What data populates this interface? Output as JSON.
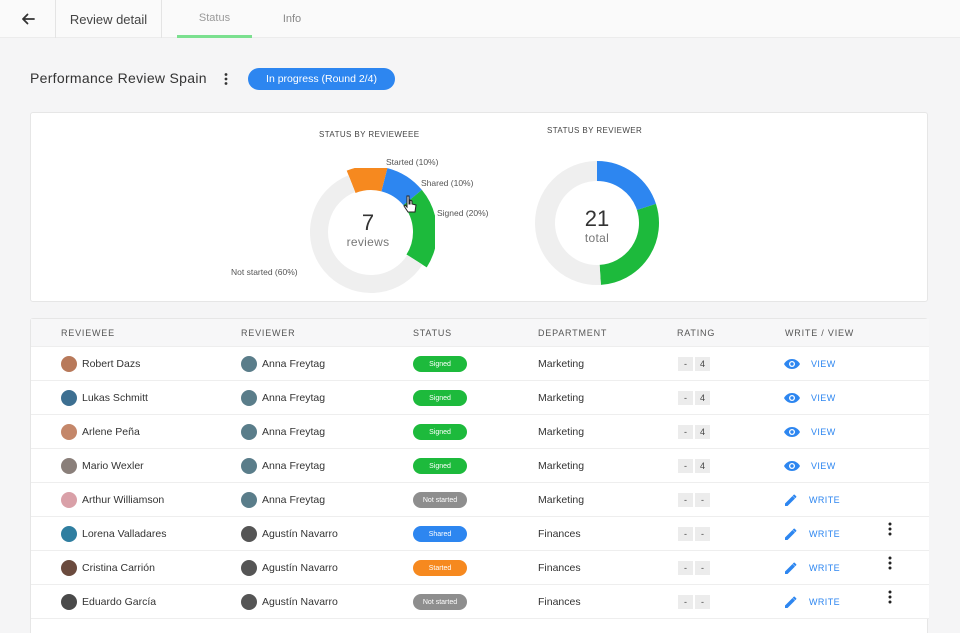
{
  "header": {
    "back_icon": "arrow-left-icon",
    "breadcrumb": "Review detail",
    "tabs": [
      {
        "label": "Status",
        "active": true
      },
      {
        "label": "Info",
        "active": false
      }
    ]
  },
  "review": {
    "title": "Performance Review Spain",
    "menu_icon": "more-vertical-icon",
    "status": "In progress (Round 2/4)"
  },
  "charts": {
    "by_reviewee": {
      "title": "STATUS BY REVIEWEEE",
      "center_value": "7",
      "center_label": "reviews",
      "labels": {
        "started": "Started (10%)",
        "shared": "Shared (10%)",
        "signed": "Signed (20%)",
        "not_started": "Not started (60%)"
      }
    },
    "by_reviewer": {
      "title": "STATUS BY REVIEWER",
      "center_value": "21",
      "center_label": "total"
    }
  },
  "chart_data": [
    {
      "type": "pie",
      "title": "STATUS BY REVIEWEEE",
      "categories": [
        "Not started",
        "Started",
        "Shared",
        "Signed"
      ],
      "values": [
        60,
        10,
        10,
        20
      ],
      "colors": [
        "#efefef",
        "#f6891f",
        "#2d86f0",
        "#1dba3c"
      ]
    },
    {
      "type": "pie",
      "title": "STATUS BY REVIEWER",
      "categories": [
        "Shared",
        "Signed",
        "Not started"
      ],
      "values": [
        20,
        29,
        51
      ],
      "colors": [
        "#2d86f0",
        "#1dba3c",
        "#efefef"
      ]
    }
  ],
  "table": {
    "headers": [
      "REVIEWEE",
      "REVIEWER",
      "STATUS",
      "DEPARTMENT",
      "RATING",
      "WRITE / VIEW"
    ],
    "rows": [
      {
        "reviewee": "Robert Dazs",
        "reviewer": "Anna Freytag",
        "status": "Signed",
        "status_color": "#1dba3c",
        "department": "Marketing",
        "rating": [
          "-",
          "4"
        ],
        "action": "VIEW",
        "action_icon": "eye-icon",
        "has_menu": false,
        "reviewee_avatar": "#b8795a",
        "reviewer_avatar": "#5a7d8a"
      },
      {
        "reviewee": "Lukas Schmitt",
        "reviewer": "Anna Freytag",
        "status": "Signed",
        "status_color": "#1dba3c",
        "department": "Marketing",
        "rating": [
          "-",
          "4"
        ],
        "action": "VIEW",
        "action_icon": "eye-icon",
        "has_menu": false,
        "reviewee_avatar": "#3d6f91",
        "reviewer_avatar": "#5a7d8a"
      },
      {
        "reviewee": "Arlene Peña",
        "reviewer": "Anna Freytag",
        "status": "Signed",
        "status_color": "#1dba3c",
        "department": "Marketing",
        "rating": [
          "-",
          "4"
        ],
        "action": "VIEW",
        "action_icon": "eye-icon",
        "has_menu": false,
        "reviewee_avatar": "#c4876a",
        "reviewer_avatar": "#5a7d8a"
      },
      {
        "reviewee": "Mario Wexler",
        "reviewer": "Anna Freytag",
        "status": "Signed",
        "status_color": "#1dba3c",
        "department": "Marketing",
        "rating": [
          "-",
          "4"
        ],
        "action": "VIEW",
        "action_icon": "eye-icon",
        "has_menu": false,
        "reviewee_avatar": "#8a7f7a",
        "reviewer_avatar": "#5a7d8a"
      },
      {
        "reviewee": "Arthur Williamson",
        "reviewer": "Anna Freytag",
        "status": "Not started",
        "status_color": "#8e8e8e",
        "department": "Marketing",
        "rating": [
          "-",
          "-"
        ],
        "action": "WRITE",
        "action_icon": "pencil-icon",
        "has_menu": false,
        "reviewee_avatar": "#d9a0a8",
        "reviewer_avatar": "#5a7d8a"
      },
      {
        "reviewee": "Lorena Valladares",
        "reviewer": "Agustín Navarro",
        "status": "Shared",
        "status_color": "#2d86f0",
        "department": "Finances",
        "rating": [
          "-",
          "-"
        ],
        "action": "WRITE",
        "action_icon": "pencil-icon",
        "has_menu": true,
        "reviewee_avatar": "#2f7ea0",
        "reviewer_avatar": "#555555"
      },
      {
        "reviewee": "Cristina Carrión",
        "reviewer": "Agustín Navarro",
        "status": "Started",
        "status_color": "#f6891f",
        "department": "Finances",
        "rating": [
          "-",
          "-"
        ],
        "action": "WRITE",
        "action_icon": "pencil-icon",
        "has_menu": true,
        "reviewee_avatar": "#6b4b3e",
        "reviewer_avatar": "#555555"
      },
      {
        "reviewee": "Eduardo García",
        "reviewer": "Agustín Navarro",
        "status": "Not started",
        "status_color": "#8e8e8e",
        "department": "Finances",
        "rating": [
          "-",
          "-"
        ],
        "action": "WRITE",
        "action_icon": "pencil-icon",
        "has_menu": true,
        "reviewee_avatar": "#4a4a4a",
        "reviewer_avatar": "#555555"
      }
    ]
  }
}
